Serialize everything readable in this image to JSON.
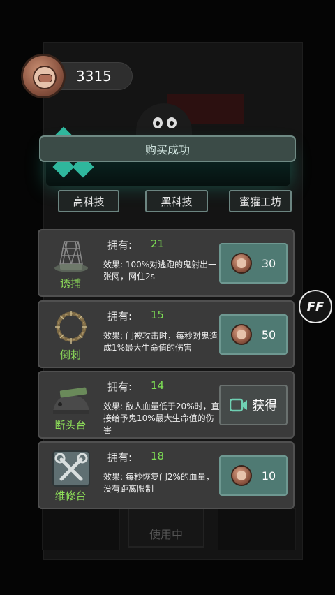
{
  "header": {
    "coins": "3315"
  },
  "toast": {
    "message": "购买成功"
  },
  "tabs": [
    {
      "label": "高科技"
    },
    {
      "label": "黑科技"
    },
    {
      "label": "蜜獾工坊"
    }
  ],
  "items": [
    {
      "name": "诱捕",
      "owned_label": "拥有:",
      "owned": "21",
      "effect": "效果:    100%对逃跑的鬼射出一张网，网住2s",
      "action": "coin",
      "price": "30"
    },
    {
      "name": "倒刺",
      "owned_label": "拥有:",
      "owned": "15",
      "effect": "效果:    门被攻击时，每秒对鬼造成1%最大生命值的伤害",
      "action": "coin",
      "price": "50"
    },
    {
      "name": "断头台",
      "owned_label": "拥有:",
      "owned": "14",
      "effect": "效果:    敌人血量低于20%时，直接给予鬼10%最大生命值的伤害",
      "action": "video",
      "action_label": "获得"
    },
    {
      "name": "维修台",
      "owned_label": "拥有:",
      "owned": "18",
      "effect": "效果:    每秒恢复门2%的血量，没有距离限制",
      "action": "coin",
      "price": "10"
    }
  ],
  "background": {
    "using_label": "使用中"
  },
  "speed_button": {
    "label": "FF"
  },
  "colors": {
    "accent_green": "#7ee055",
    "button_teal": "#4f7a73",
    "toast_bg": "#3b4b47"
  },
  "icons": [
    "coin-icon",
    "net-trap-icon",
    "thorn-wreath-icon",
    "guillotine-icon",
    "repair-tools-icon",
    "video-icon"
  ]
}
